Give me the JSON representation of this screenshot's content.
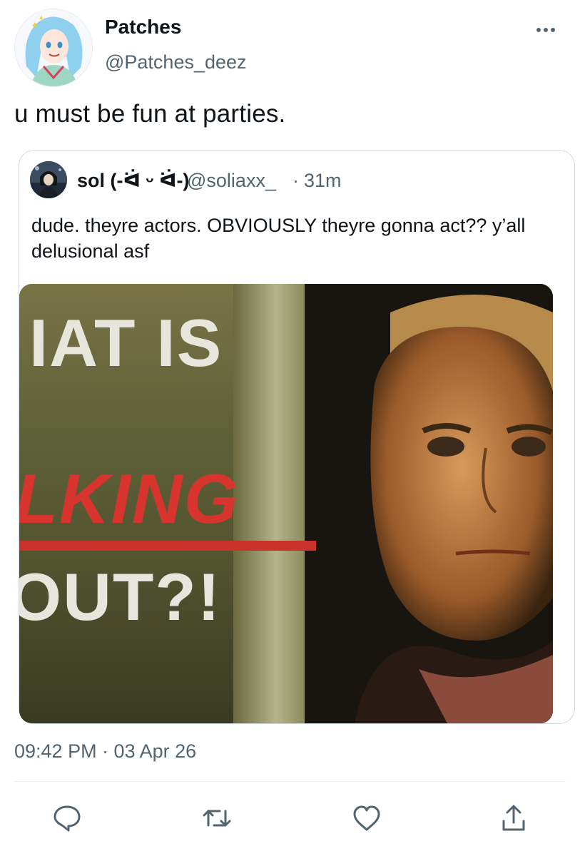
{
  "author": {
    "name": "Patches",
    "handle": "@Patches_deez"
  },
  "tweet": {
    "text": "u must be fun at parties."
  },
  "quoted": {
    "name": "sol (‐ᐛ ᵕ ᐛ‐)",
    "handle": "@soliaxx_",
    "separator": "·",
    "time": "31m",
    "text": "dude. theyre actors. OBVIOUSLY theyre gonna act?? y’all delusional asf",
    "media": {
      "overlay_lines": [
        "IAT IS",
        "LKING",
        "OUT?!"
      ]
    }
  },
  "meta": {
    "timestamp": "09:42 PM · 03 Apr 26"
  },
  "actions": {
    "reply": "reply-icon",
    "retweet": "retweet-icon",
    "like": "like-icon",
    "share": "share-icon"
  },
  "colors": {
    "text": "#0f1419",
    "secondary": "#536471",
    "border": "#cfd9de",
    "meme_red": "#d8342e"
  }
}
